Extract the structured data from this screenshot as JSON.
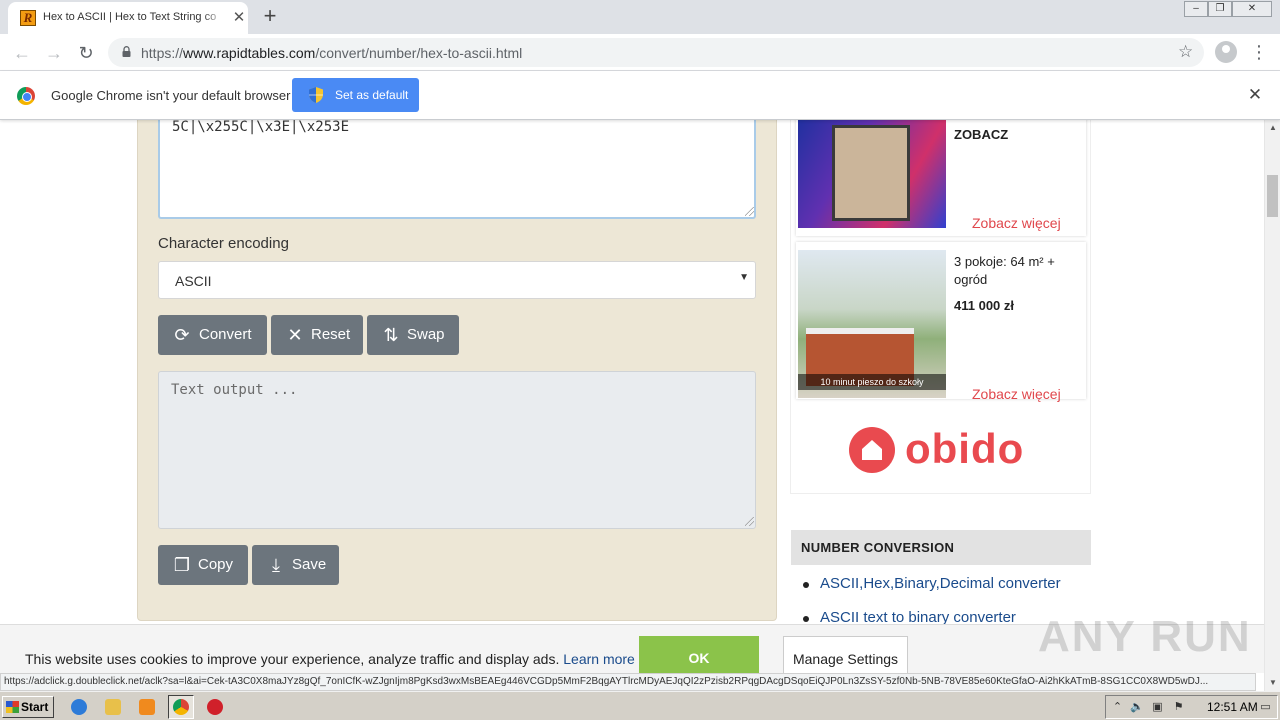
{
  "browser": {
    "tab_title": "Hex to ASCII | Hex to Text String co",
    "tab_favicon_letter": "R",
    "new_tab": "+",
    "tab_close": "✕",
    "window_controls": {
      "minimize": "–",
      "maximize": "❐",
      "close": "✕"
    },
    "url_scheme": "https://",
    "url_host": "www.rapidtables.com",
    "url_path": "/convert/number/hex-to-ascii.html",
    "nav": {
      "back": "←",
      "forward": "→",
      "reload": "↻",
      "star": "☆",
      "menu": "⋮"
    }
  },
  "infobar": {
    "message": "Google Chrome isn't your default browser",
    "button": "Set as default",
    "close": "✕"
  },
  "converter": {
    "input_text": "5C|\\x255C|\\x3E|\\x253E",
    "encoding_label": "Character encoding",
    "encoding_value": "ASCII",
    "select_arrow": "▼",
    "buttons": {
      "convert": "Convert",
      "reset": "Reset",
      "swap": "Swap",
      "copy": "Copy",
      "save": "Save"
    },
    "icons": {
      "convert": "⟳",
      "reset": "✕",
      "swap": "⇅",
      "copy": "❐",
      "save": "⤓"
    },
    "output_placeholder": "Text output ..."
  },
  "ads": {
    "ad1": {
      "title": "ZOBACZ",
      "more": "Zobacz więcej"
    },
    "ad2": {
      "title": "3 pokoje: 64 m² + ogród",
      "price": "411 000 zł",
      "caption": "10 minut pieszo do szkoły",
      "more": "Zobacz więcej"
    },
    "brand": "obido"
  },
  "sidebar": {
    "section_title": "NUMBER CONVERSION",
    "links": [
      "ASCII,Hex,Binary,Decimal converter",
      "ASCII text to binary converter"
    ]
  },
  "cookie": {
    "message": "This website uses cookies to improve your experience, analyze traffic and display ads.",
    "learn_more": "Learn more",
    "ok": "OK",
    "manage": "Manage Settings"
  },
  "status_url": "https://adclick.g.doubleclick.net/aclk?sa=l&ai=Cek-tA3C0X8maJYz8gQf_7onICfK-wZJgnIjm8PgKsd3wxMsBEAEg446VCGDp5MmF2BqgAYTlrcMDyAEJqQI2zPzisb2RPqgDAcgDSqoEiQJP0Ln3ZsSY-5zf0Nb-5NB-78VE85e60KteGfaO-Ai2hKkATmB-8SG1CC0X8WD5wDJ...",
  "watermark": "ANY RUN",
  "scroll": {
    "up": "▲",
    "down": "▼"
  },
  "taskbar": {
    "start": "Start",
    "clock": "12:51 AM",
    "tray_icons": [
      "⌃",
      "🔈",
      "▣",
      "⚑",
      "▭"
    ]
  }
}
